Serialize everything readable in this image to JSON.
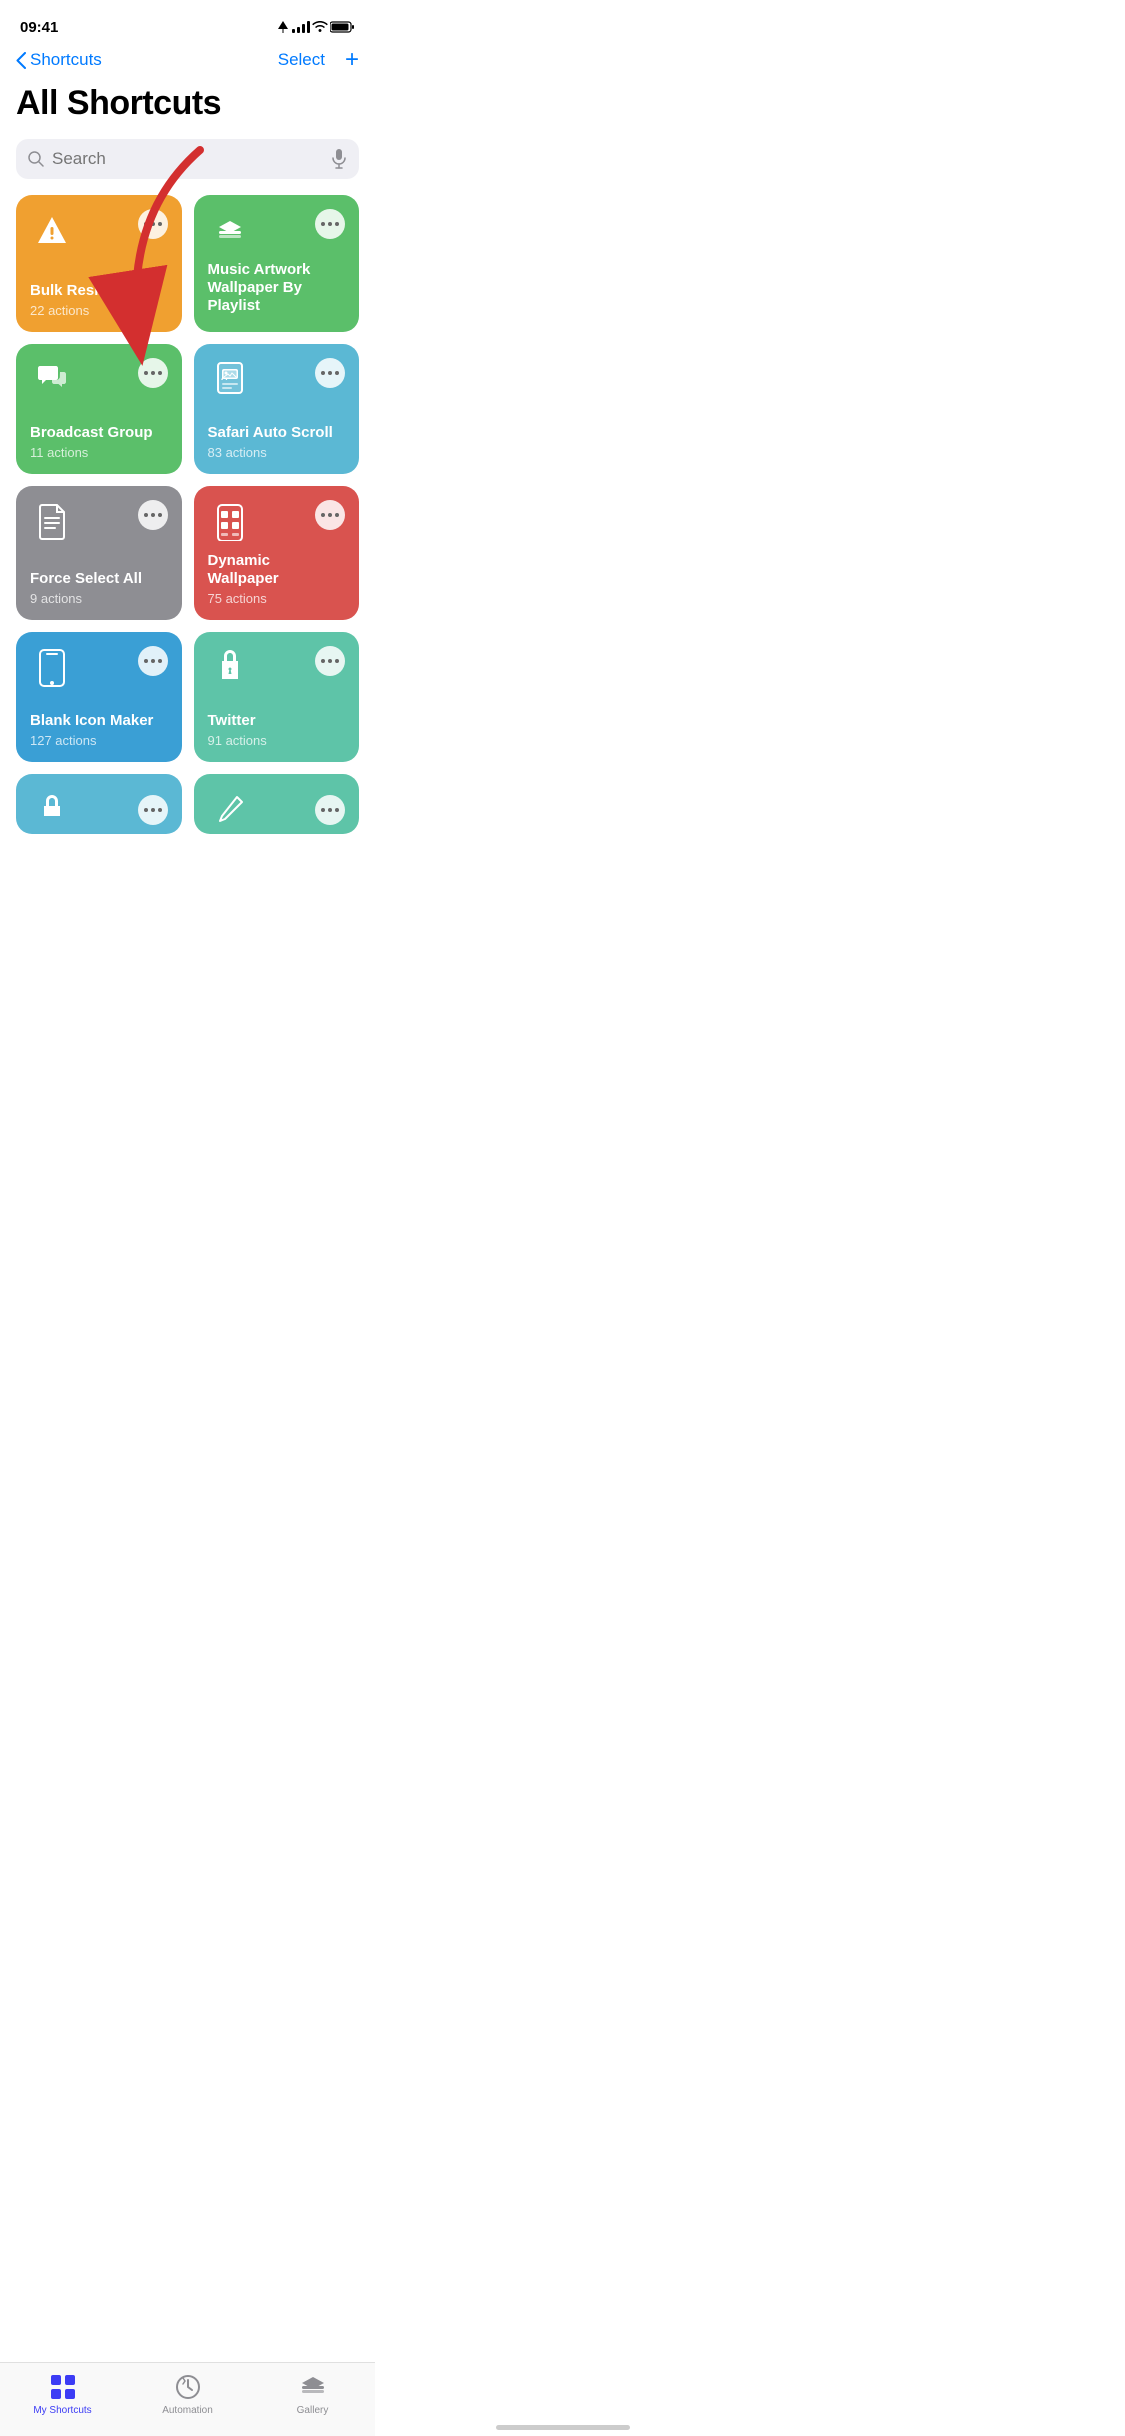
{
  "status": {
    "time": "09:41",
    "location_icon": true
  },
  "nav": {
    "back_label": "Shortcuts",
    "select_label": "Select",
    "plus_label": "+"
  },
  "page": {
    "title": "All Shortcuts"
  },
  "search": {
    "placeholder": "Search"
  },
  "shortcuts": [
    {
      "name": "Bulk Resize",
      "actions": "22 actions",
      "color": "#F0A030",
      "icon": "warning"
    },
    {
      "name": "Music Artwork Wallpaper By Playlist",
      "actions": "",
      "color": "#5BBF6A",
      "icon": "layers"
    },
    {
      "name": "Broadcast Group",
      "actions": "11 actions",
      "color": "#5BBF6A",
      "icon": "chat"
    },
    {
      "name": "Safari Auto Scroll",
      "actions": "83 actions",
      "color": "#5BB8D4",
      "icon": "document-image"
    },
    {
      "name": "Force Select All",
      "actions": "9 actions",
      "color": "#8E8E93",
      "icon": "document"
    },
    {
      "name": "Dynamic Wallpaper",
      "actions": "75 actions",
      "color": "#D9534F",
      "icon": "grid-phone"
    },
    {
      "name": "Blank Icon Maker",
      "actions": "127 actions",
      "color": "#3A9FD5",
      "icon": "phone"
    },
    {
      "name": "Twitter",
      "actions": "91 actions",
      "color": "#5EC4A8",
      "icon": "lock"
    }
  ],
  "partial_cards": [
    {
      "color": "#5BB8D4",
      "icon": "lock"
    },
    {
      "color": "#5EC4A8",
      "icon": "pen"
    }
  ],
  "tabs": [
    {
      "id": "my-shortcuts",
      "label": "My Shortcuts",
      "icon": "grid",
      "active": true
    },
    {
      "id": "automation",
      "label": "Automation",
      "icon": "clock-check",
      "active": false
    },
    {
      "id": "gallery",
      "label": "Gallery",
      "icon": "layers",
      "active": false
    }
  ]
}
